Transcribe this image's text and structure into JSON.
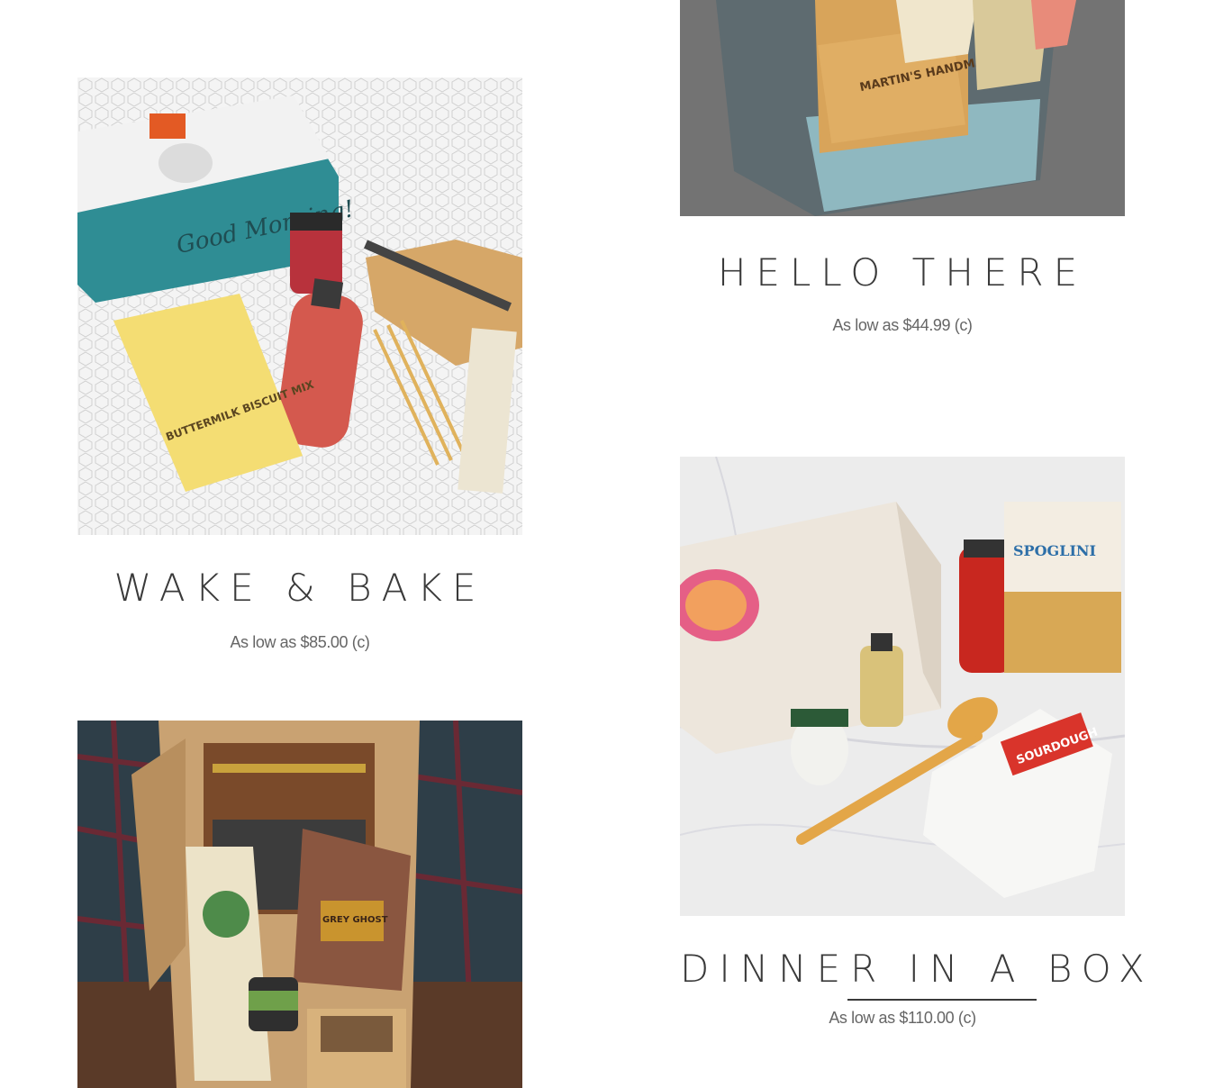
{
  "products": [
    {
      "title": "HELLO THERE",
      "price": "As low as $44.99 (c)",
      "image_alt": "Gift box with Martin's Handmade snack and crackers",
      "box_text": "MARTIN'S HANDMADE"
    },
    {
      "title": "WAKE & BAKE",
      "price": "As low as $85.00 (c)",
      "image_alt": "Good Morning box with buttermilk biscuit mix, jam, sauce bottle, knife and cutting board",
      "box_text": "Good Morning!",
      "bag_text": "BUTTERMILK BISCUIT MIX"
    },
    {
      "title": "DINNER IN A BOX",
      "price": "As low as $110.00 (c)",
      "image_alt": "Dinner box with sauce jar, Spoglini pasta, olive oil, garlic, wooden spoon and sourdough bread mix",
      "pasta_text": "SPOGLINI",
      "bag_text": "SOURDOUGH"
    },
    {
      "title": "",
      "price": "",
      "image_alt": "Open kraft box on plaid blanket with notepad, pen, coffee bag, mustard and Grey Ghost bakery cookies",
      "brand_text": "GREY GHOST"
    }
  ]
}
